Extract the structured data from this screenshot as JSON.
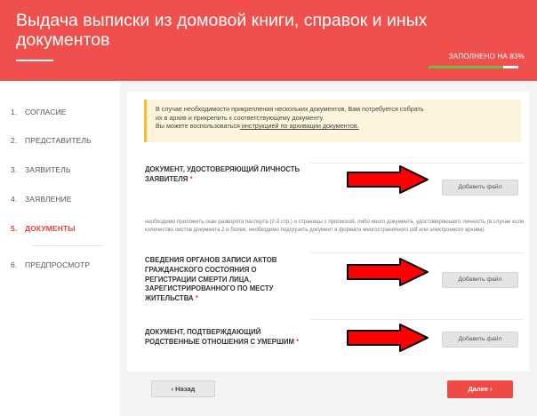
{
  "header": {
    "title": "Выдача выписки из домовой книги, справок и иных документов",
    "progress_label": "ЗАПОЛНЕНО НА 83%",
    "progress_percent": 83
  },
  "sidebar": {
    "steps": [
      {
        "num": "1.",
        "label": "СОГЛАСИЕ"
      },
      {
        "num": "2.",
        "label": "ПРЕДСТАВИТЕЛЬ"
      },
      {
        "num": "3.",
        "label": "ЗАЯВИТЕЛЬ"
      },
      {
        "num": "4.",
        "label": "ЗАЯВЛЕНИЕ"
      },
      {
        "num": "5.",
        "label": "ДОКУМЕНТЫ"
      },
      {
        "num": "6.",
        "label": "ПРЕДПРОСМОТР"
      }
    ]
  },
  "notice": {
    "line1": "В случае необходимости прикрепления нескольких документов, Вам потребуется собрать",
    "line2": "их в архив и прикрепить к соответствующему документу.",
    "line3_prefix": "Вы можете воспользоваться",
    "line3_link": " инструкцией по архивации документов."
  },
  "documents": [
    {
      "lines": [
        "ДОКУМЕНТ, УДОСТОВЕРЯЮЩИЙ ЛИЧНОСТЬ",
        "ЗАЯВИТЕЛЯ"
      ],
      "button": "Добавить файл"
    },
    {
      "lines": [
        "СВЕДЕНИЯ ОРГАНОВ ЗАПИСИ АКТОВ",
        "ГРАЖДАНСКОГО СОСТОЯНИЯ О",
        "РЕГИСТРАЦИИ СМЕРТИ ЛИЦА,",
        "ЗАРЕГИСТРИРОВАННОГО ПО МЕСТУ",
        "ЖИТЕЛЬСТВА"
      ],
      "button": "Добавить файл"
    },
    {
      "lines": [
        "ДОКУМЕНТ, ПОДТВЕРЖДАЮЩИЙ",
        "РОДСТВЕННЫЕ ОТНОШЕНИЯ С УМЕРШИМ"
      ],
      "button": "Добавить файл"
    }
  ],
  "required_mark": "*",
  "hint": "необходимо приложить скан разворота паспорта (2-3 стр.) и страницы с пропиской, либо иного документа, удостоверяющего личность (в случае если количество листов документа 2 и более, необходимо подгрузить документ в формате многостраничного pdf или электронного архива)",
  "footer": {
    "back_label": "‹ Назад",
    "next_label": "Далее ›"
  },
  "colors": {
    "brand": "#f0504d",
    "progress": "#6dbd45",
    "arrow": "#ff0000"
  }
}
